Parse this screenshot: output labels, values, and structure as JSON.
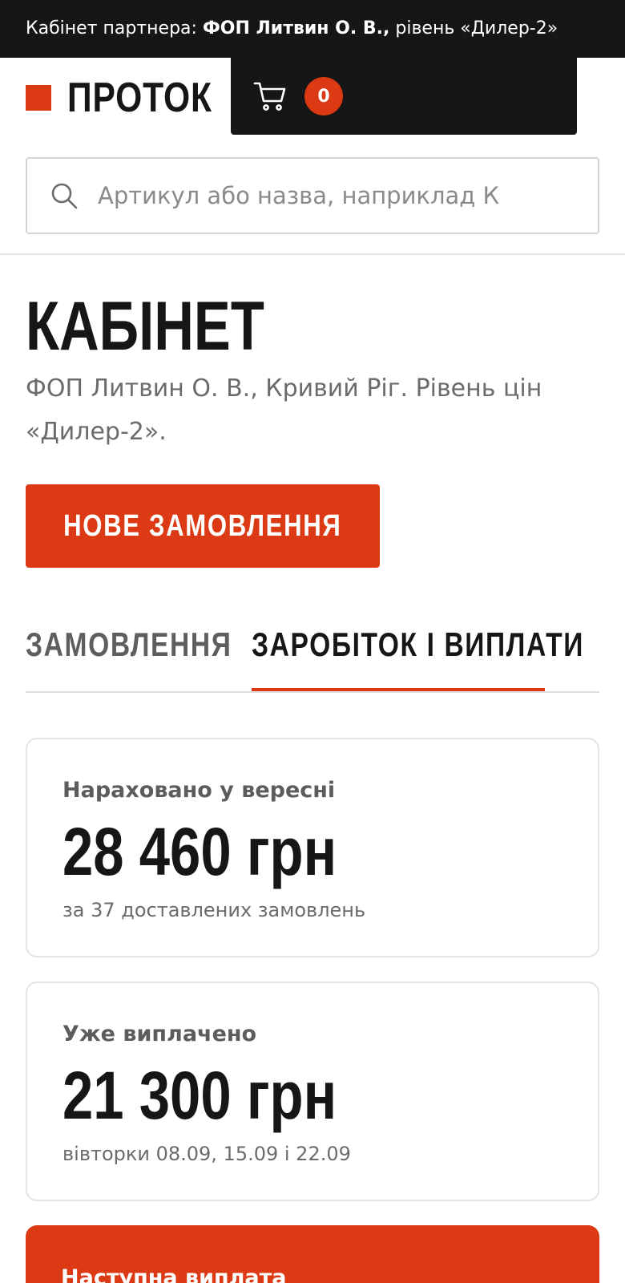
{
  "banner": {
    "prefix": "Кабінет партнера: ",
    "partner": "ФОП Литвин О. В.,",
    "suffix": " рівень «Дилер-2»"
  },
  "header": {
    "logo": "ПРОТОК",
    "cart_count": "0"
  },
  "search": {
    "placeholder": "Артикул або назва, наприклад К"
  },
  "page": {
    "title": "КАБІНЕТ",
    "subtitle": "ФОП Литвин О. В., Кривий Ріг. Рівень цін «Дилер-2».",
    "new_order_label": "НОВЕ ЗАМОВЛЕННЯ"
  },
  "tabs": [
    {
      "label": "ЗАМОВЛЕННЯ",
      "active": false
    },
    {
      "label": "ЗАРОБІТОК І ВИПЛАТИ",
      "active": true
    }
  ],
  "cards": [
    {
      "label": "Нараховано у вересні",
      "amount": "28 460 грн",
      "note": "за 37 доставлених замовлень"
    },
    {
      "label": "Уже виплачено",
      "amount": "21 300 грн",
      "note": "вівторки 08.09, 15.09 і 22.09"
    }
  ],
  "next_payout": {
    "label": "Наступна виплата"
  },
  "colors": {
    "accent": "#dc3a14",
    "dark": "#161616",
    "muted": "#6b6b6b"
  }
}
